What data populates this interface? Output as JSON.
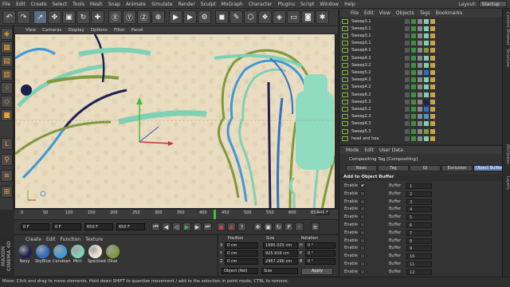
{
  "menubar": {
    "items": [
      "File",
      "Edit",
      "Create",
      "Select",
      "Tools",
      "Mesh",
      "Snap",
      "Animate",
      "Simulate",
      "Render",
      "Sculpt",
      "MoGraph",
      "Character",
      "Plugins",
      "Script",
      "Window",
      "Help"
    ],
    "layout_label": "Layout:",
    "layout_value": "Startup"
  },
  "viewport_menu": [
    "View",
    "Cameras",
    "Display",
    "Options",
    "Filter",
    "Panel"
  ],
  "timeline": {
    "ticks": [
      "0",
      "50",
      "100",
      "150",
      "200",
      "250",
      "300",
      "350",
      "400",
      "450",
      "500",
      "550",
      "600",
      "650"
    ],
    "end_label": "446 F"
  },
  "transport": {
    "start_field": "0 F",
    "current_field": "0 F",
    "end_field": "650 F",
    "max_field": "650 F"
  },
  "materials": {
    "menu": [
      "Create",
      "Edit",
      "Function",
      "Texture"
    ],
    "items": [
      {
        "name": "Navy",
        "color": "#1c2050"
      },
      {
        "name": "SkyBlue",
        "color": "#2f6fc8"
      },
      {
        "name": "Cerulean",
        "color": "#3d9ad8"
      },
      {
        "name": "Mint",
        "color": "#7fd1b5"
      },
      {
        "name": "Speckled",
        "color": "#ede3cf"
      },
      {
        "name": "Olive",
        "color": "#7e9a3c"
      }
    ]
  },
  "coordinates": {
    "headers": [
      "Position",
      "Size",
      "Rotation"
    ],
    "rows": [
      {
        "axis": "X",
        "pos": "0 cm",
        "size": "1995.025 cm",
        "rot_axis": "H",
        "rot": "0 °"
      },
      {
        "axis": "Y",
        "pos": "0 cm",
        "size": "925.916 cm",
        "rot_axis": "P",
        "rot": "0 °"
      },
      {
        "axis": "Z",
        "pos": "0 cm",
        "size": "2967.296 cm",
        "rot_axis": "B",
        "rot": "0 °"
      }
    ],
    "mode_left": "Object (Rel)",
    "mode_right": "Size",
    "apply": "Apply"
  },
  "objects": {
    "menu": [
      "File",
      "Edit",
      "View",
      "Objects",
      "Tags",
      "Bookmarks"
    ],
    "rows": [
      {
        "name": "Sweep3.1",
        "tag": "#7fd1b5"
      },
      {
        "name": "Sweep3.1",
        "tag": "#7fd1b5"
      },
      {
        "name": "Sweep3.1",
        "tag": "#7fd1b5"
      },
      {
        "name": "Sweep5.1",
        "tag": "#7fd1b5"
      },
      {
        "name": "Sweep4.1",
        "tag": "#7e9a3c"
      },
      {
        "name": "Sweep4.2",
        "tag": "#7fd1b5"
      },
      {
        "name": "Sweep3.2",
        "tag": "#7fd1b5"
      },
      {
        "name": "Sweep5.2",
        "tag": "#2f6fc8"
      },
      {
        "name": "Sweep4.2",
        "tag": "#7fd1b5"
      },
      {
        "name": "Sweep4.2",
        "tag": "#7fd1b5"
      },
      {
        "name": "Sweep6.2",
        "tag": "#7fd1b5"
      },
      {
        "name": "Sweep5.3",
        "tag": "#1c2050"
      },
      {
        "name": "Sweep5.2",
        "tag": "#2f6fc8"
      },
      {
        "name": "Sweep2.3",
        "tag": "#3d9ad8"
      },
      {
        "name": "Sweep4.3",
        "tag": "#7fd1b5"
      },
      {
        "name": "Sweep5.3",
        "tag": "#7e9a3c"
      },
      {
        "name": "head and hea",
        "tag": "#7fd1b5"
      }
    ]
  },
  "attributes": {
    "menu": [
      "Mode",
      "Edit",
      "User Data"
    ],
    "title": "Compositing Tag [Compositing]",
    "tabs": [
      "Basic",
      "Tag",
      "GI",
      "Exclusion",
      "Object Buffer"
    ],
    "active_tab": "Object Buffer",
    "section": "Add to Object Buffer",
    "rows": [
      {
        "enable": "Enable",
        "checked": true,
        "buffer": "Buffer",
        "value": "1"
      },
      {
        "enable": "Enable",
        "checked": false,
        "buffer": "Buffer",
        "value": "2"
      },
      {
        "enable": "Enable",
        "checked": false,
        "buffer": "Buffer",
        "value": "3"
      },
      {
        "enable": "Enable",
        "checked": false,
        "buffer": "Buffer",
        "value": "4"
      },
      {
        "enable": "Enable",
        "checked": false,
        "buffer": "Buffer",
        "value": "5"
      },
      {
        "enable": "Enable",
        "checked": false,
        "buffer": "Buffer",
        "value": "6"
      },
      {
        "enable": "Enable",
        "checked": false,
        "buffer": "Buffer",
        "value": "7"
      },
      {
        "enable": "Enable",
        "checked": false,
        "buffer": "Buffer",
        "value": "8"
      },
      {
        "enable": "Enable",
        "checked": false,
        "buffer": "Buffer",
        "value": "9"
      },
      {
        "enable": "Enable",
        "checked": false,
        "buffer": "Buffer",
        "value": "10"
      },
      {
        "enable": "Enable",
        "checked": false,
        "buffer": "Buffer",
        "value": "11"
      },
      {
        "enable": "Enable",
        "checked": false,
        "buffer": "Buffer",
        "value": "12"
      }
    ]
  },
  "side_tabs": [
    "Content Browser",
    "Structure",
    "Attributes",
    "Layers"
  ],
  "status": "Move: Click and drag to move elements. Hold down SHIFT to quantize movement / add to the selection in point mode, CTRL to remove."
}
